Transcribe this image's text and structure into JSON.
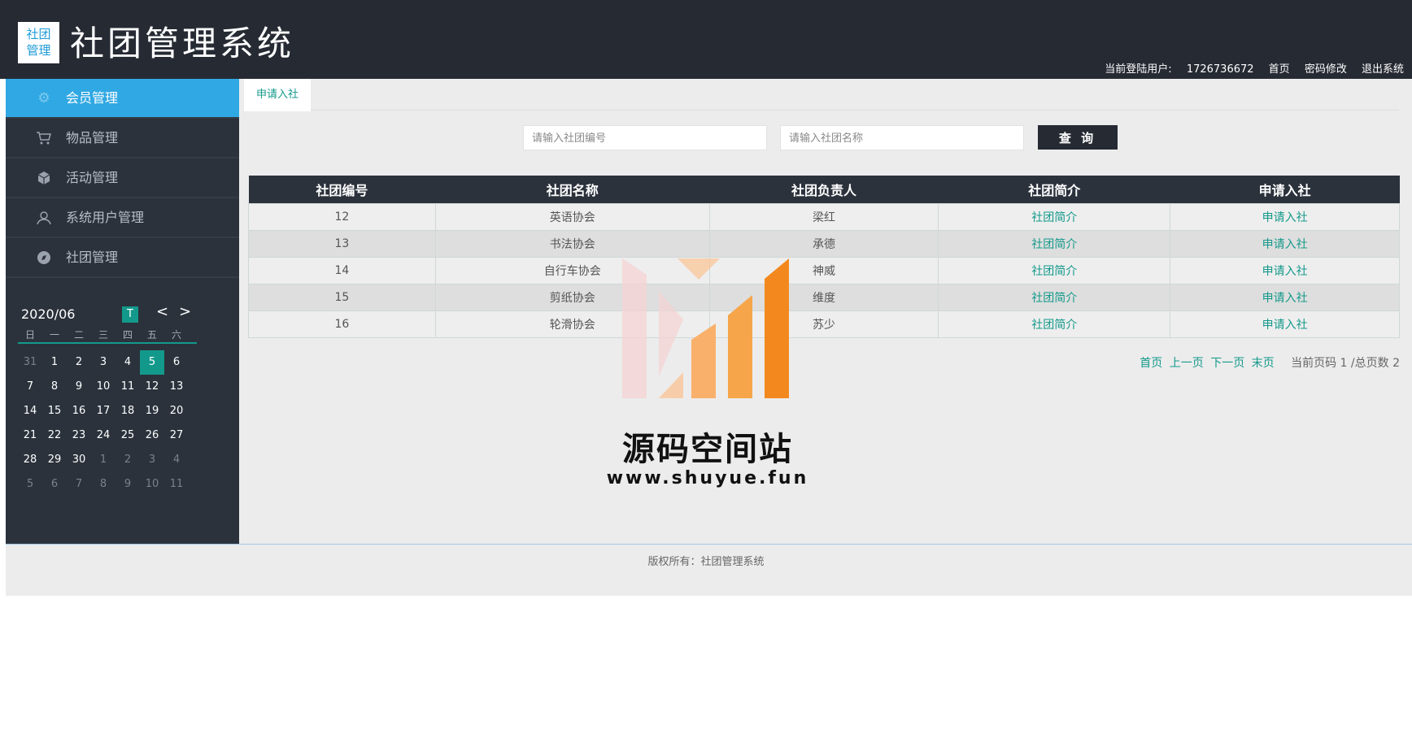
{
  "header": {
    "logo_text": [
      "社团",
      "管理"
    ],
    "title": "社团管理系统",
    "user_label": "当前登陆用户:",
    "user_id": "1726736672",
    "links": [
      "首页",
      "密码修改",
      "退出系统"
    ]
  },
  "sidebar": {
    "items": [
      {
        "label": "会员管理",
        "icon": "gear-icon",
        "active": true
      },
      {
        "label": "物品管理",
        "icon": "cart-icon",
        "active": false
      },
      {
        "label": "活动管理",
        "icon": "cube-icon",
        "active": false
      },
      {
        "label": "系统用户管理",
        "icon": "user-icon",
        "active": false
      },
      {
        "label": "社团管理",
        "icon": "compass-icon",
        "active": false
      }
    ]
  },
  "calendar": {
    "month": "2020/06",
    "today_label": "T",
    "prev": "<",
    "next": ">",
    "weekdays": [
      "日",
      "一",
      "二",
      "三",
      "四",
      "五",
      "六"
    ],
    "days": [
      {
        "d": "31",
        "o": true
      },
      {
        "d": "1"
      },
      {
        "d": "2"
      },
      {
        "d": "3"
      },
      {
        "d": "4"
      },
      {
        "d": "5",
        "s": true
      },
      {
        "d": "6"
      },
      {
        "d": "7"
      },
      {
        "d": "8"
      },
      {
        "d": "9"
      },
      {
        "d": "10"
      },
      {
        "d": "11"
      },
      {
        "d": "12"
      },
      {
        "d": "13"
      },
      {
        "d": "14"
      },
      {
        "d": "15"
      },
      {
        "d": "16"
      },
      {
        "d": "17"
      },
      {
        "d": "18"
      },
      {
        "d": "19"
      },
      {
        "d": "20"
      },
      {
        "d": "21"
      },
      {
        "d": "22"
      },
      {
        "d": "23"
      },
      {
        "d": "24"
      },
      {
        "d": "25"
      },
      {
        "d": "26"
      },
      {
        "d": "27"
      },
      {
        "d": "28"
      },
      {
        "d": "29"
      },
      {
        "d": "30"
      },
      {
        "d": "1",
        "o": true
      },
      {
        "d": "2",
        "o": true
      },
      {
        "d": "3",
        "o": true
      },
      {
        "d": "4",
        "o": true
      },
      {
        "d": "5",
        "o": true
      },
      {
        "d": "6",
        "o": true
      },
      {
        "d": "7",
        "o": true
      },
      {
        "d": "8",
        "o": true
      },
      {
        "d": "9",
        "o": true
      },
      {
        "d": "10",
        "o": true
      },
      {
        "d": "11",
        "o": true
      }
    ]
  },
  "tab": {
    "label": "申请入社"
  },
  "search": {
    "code_placeholder": "请输入社团编号",
    "name_placeholder": "请输入社团名称",
    "button": "查 询"
  },
  "table": {
    "headers": [
      "社团编号",
      "社团名称",
      "社团负责人",
      "社团简介",
      "申请入社"
    ],
    "rows": [
      [
        "12",
        "英语协会",
        "梁红",
        "社团简介",
        "申请入社"
      ],
      [
        "13",
        "书法协会",
        "承德",
        "社团简介",
        "申请入社"
      ],
      [
        "14",
        "自行车协会",
        "神威",
        "社团简介",
        "申请入社"
      ],
      [
        "15",
        "剪纸协会",
        "维度",
        "社团简介",
        "申请入社"
      ],
      [
        "16",
        "轮滑协会",
        "苏少",
        "社团简介",
        "申请入社"
      ]
    ]
  },
  "pager": {
    "links": [
      "首页",
      "上一页",
      "下一页",
      "末页"
    ],
    "info": "当前页码 1 /总页数 2"
  },
  "watermark": {
    "title": "源码空间站",
    "url": "www.shuyue.fun",
    "colors": [
      "#f5d3d3",
      "#f9c89e",
      "#f6a54a",
      "#f3891e"
    ]
  },
  "footer": {
    "copyright": "版权所有：社团管理系统"
  }
}
